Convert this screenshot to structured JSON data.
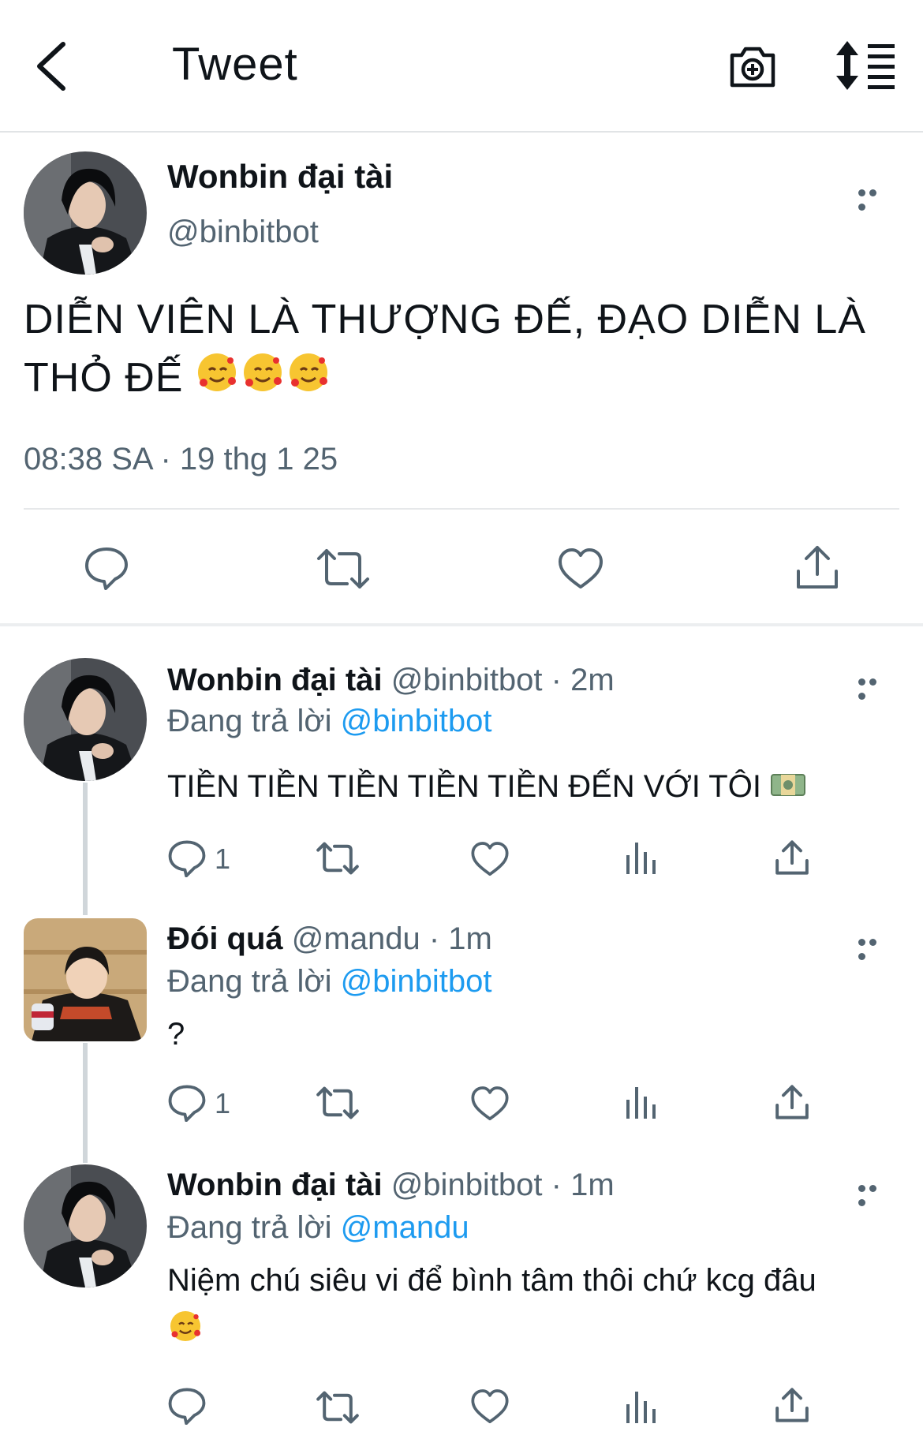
{
  "header": {
    "title": "Tweet"
  },
  "colors": {
    "accent": "#1d9bf0",
    "muted": "#536471",
    "text": "#0f1419",
    "divider": "#e6e8ea"
  },
  "icons": [
    "back-arrow-icon",
    "camera-add-icon",
    "sort-icon",
    "more-icon",
    "reply-icon",
    "retweet-icon",
    "like-icon",
    "views-icon",
    "share-icon",
    "smiling-hearts-emoji",
    "money-emoji"
  ],
  "main_tweet": {
    "name": "Wonbin đại tài",
    "handle": "@binbitbot",
    "text": "DIỄN VIÊN LÀ THƯỢNG ĐẾ, ĐẠO DIỄN LÀ THỎ ĐẾ",
    "timestamp": "08:38 SA · 19 thg 1 25"
  },
  "replies": [
    {
      "name": "Wonbin đại tài",
      "handle": "@binbitbot",
      "time": "· 2m",
      "replying_prefix": "Đang trả lời",
      "replying_to": "@binbitbot",
      "text": "TIỀN TIỀN TIỀN TIỀN TIỀN ĐẾN VỚI TÔI",
      "reply_count": "1"
    },
    {
      "name": "Đói quá",
      "handle": "@mandu",
      "time": "· 1m",
      "replying_prefix": "Đang trả lời",
      "replying_to": "@binbitbot",
      "text": "?",
      "reply_count": "1"
    },
    {
      "name": "Wonbin đại tài",
      "handle": "@binbitbot",
      "time": "· 1m",
      "replying_prefix": "Đang trả lời",
      "replying_to": "@mandu",
      "text": "Niệm chú siêu vi để bình tâm thôi chứ kcg đâu",
      "reply_count": ""
    }
  ]
}
